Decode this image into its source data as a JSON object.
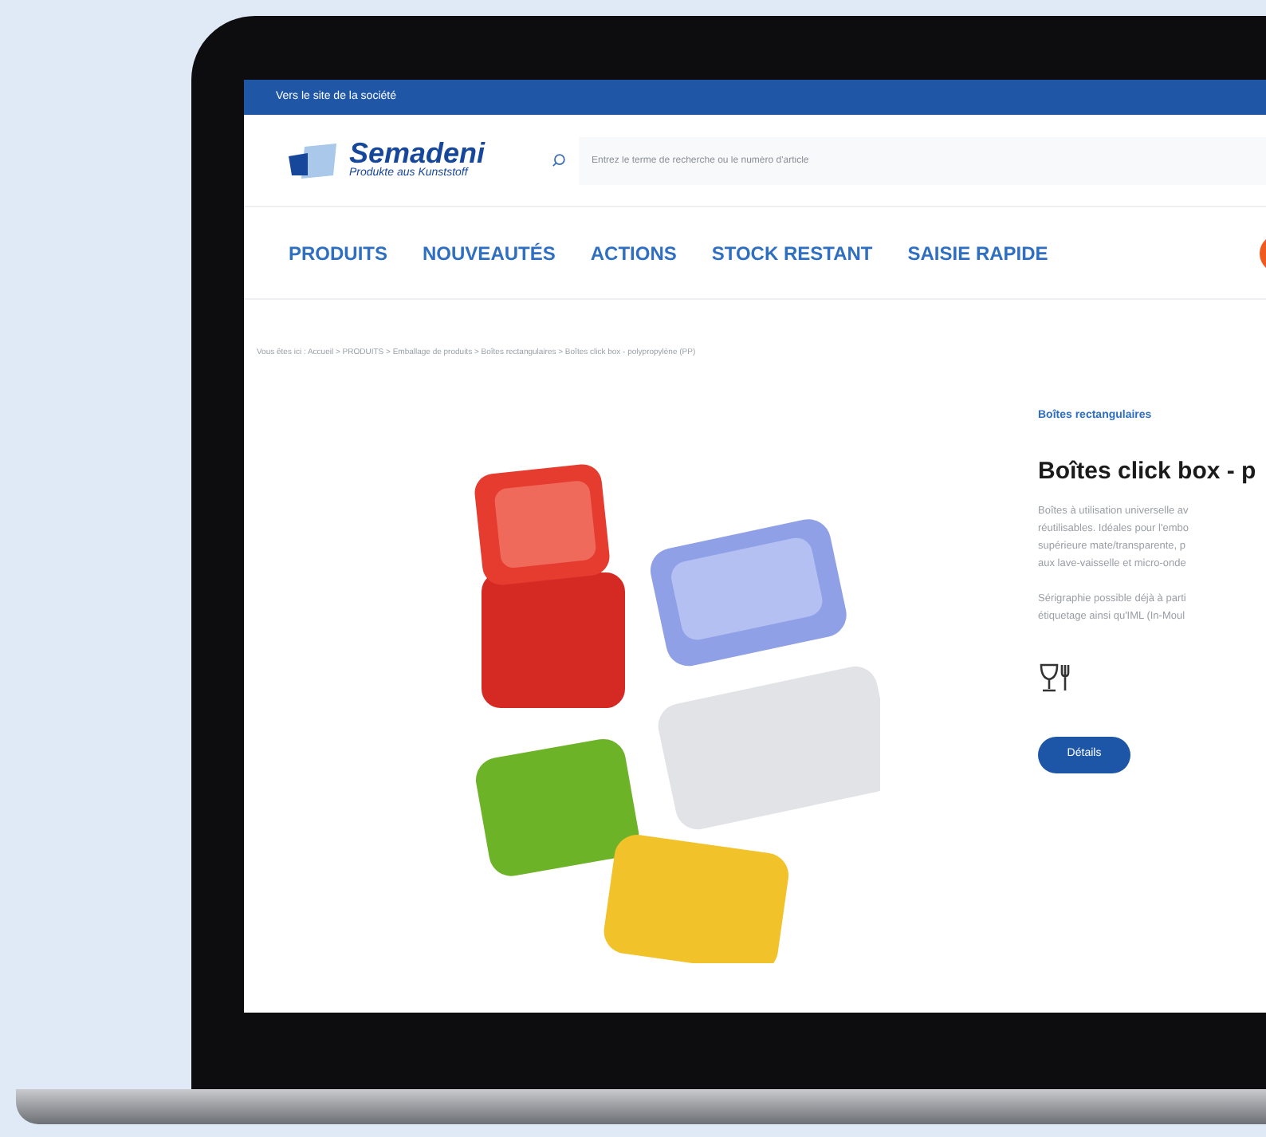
{
  "top_bar": {
    "link": "Vers le site de la société"
  },
  "header": {
    "logo_name": "Semadeni",
    "logo_tagline": "Produkte aus Kunststoff",
    "search": {
      "placeholder": "Entrez le terme de recherche ou le numéro d'article"
    }
  },
  "nav": [
    "PRODUITS",
    "NOUVEAUTÉS",
    "ACTIONS",
    "STOCK RESTANT",
    "SAISIE RAPIDE"
  ],
  "breadcrumb": "Vous êtes ici : Accueil > PRODUITS > Emballage de produits > Boîtes rectangulaires > Boîtes click box - polypropylène (PP)",
  "product": {
    "category": "Boîtes rectangulaires",
    "title": "Boîtes click box - p",
    "description_lines": [
      "Boîtes à utilisation universelle av",
      "réutilisables. Idéales pour l'embo",
      "supérieure mate/transparente, p",
      "aux lave-vaisselle et micro-onde"
    ],
    "print_lines": [
      "Sérigraphie possible déjà à parti",
      "étiquetage ainsi qu'IML (In-Moul"
    ],
    "details_button": "Détails"
  }
}
